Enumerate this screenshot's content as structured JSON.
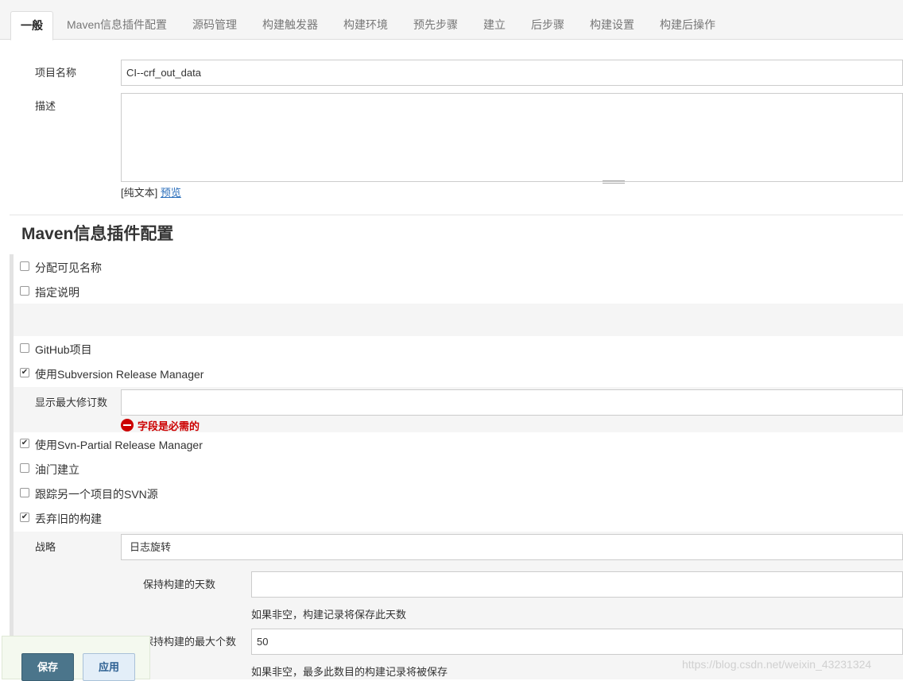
{
  "tabs": [
    {
      "label": "一般",
      "active": true
    },
    {
      "label": "Maven信息插件配置"
    },
    {
      "label": "源码管理"
    },
    {
      "label": "构建触发器"
    },
    {
      "label": "构建环境"
    },
    {
      "label": "预先步骤"
    },
    {
      "label": "建立"
    },
    {
      "label": "后步骤"
    },
    {
      "label": "构建设置"
    },
    {
      "label": "构建后操作"
    }
  ],
  "general": {
    "project_name_label": "项目名称",
    "project_name_value": "CI--crf_out_data",
    "description_label": "描述",
    "description_value": "",
    "format_plain": "[纯文本]",
    "format_preview": "预览"
  },
  "maven_section": {
    "title": "Maven信息插件配置",
    "options": [
      {
        "label": "分配可见名称",
        "checked": false
      },
      {
        "label": "指定说明",
        "checked": false
      },
      {
        "label": "GitHub项目",
        "checked": false
      },
      {
        "label": "使用Subversion Release Manager",
        "checked": true
      },
      {
        "label": "使用Svn-Partial Release Manager",
        "checked": true
      },
      {
        "label": "油门建立",
        "checked": false
      },
      {
        "label": "跟踪另一个项目的SVN源",
        "checked": false
      },
      {
        "label": "丢弃旧的构建",
        "checked": true
      }
    ],
    "max_revisions_label": "显示最大修订数",
    "max_revisions_value": "",
    "required_error": "字段是必需的",
    "strategy_label": "战略",
    "strategy_value": "日志旋转",
    "days_label": "保持构建的天数",
    "days_value": "",
    "days_hint": "如果非空，构建记录将保存此天数",
    "max_builds_label": "保持构建的最大个数",
    "max_builds_value": "50",
    "max_builds_hint": "如果非空，最多此数目的构建记录将被保存"
  },
  "buttons": {
    "save": "保存",
    "apply": "应用"
  },
  "watermark": "https://blog.csdn.net/weixin_43231324",
  "colors": {
    "save_button": "#4b758b",
    "apply_button": "#e3eef8",
    "error": "#cc0000",
    "link": "#2a6ebb"
  }
}
